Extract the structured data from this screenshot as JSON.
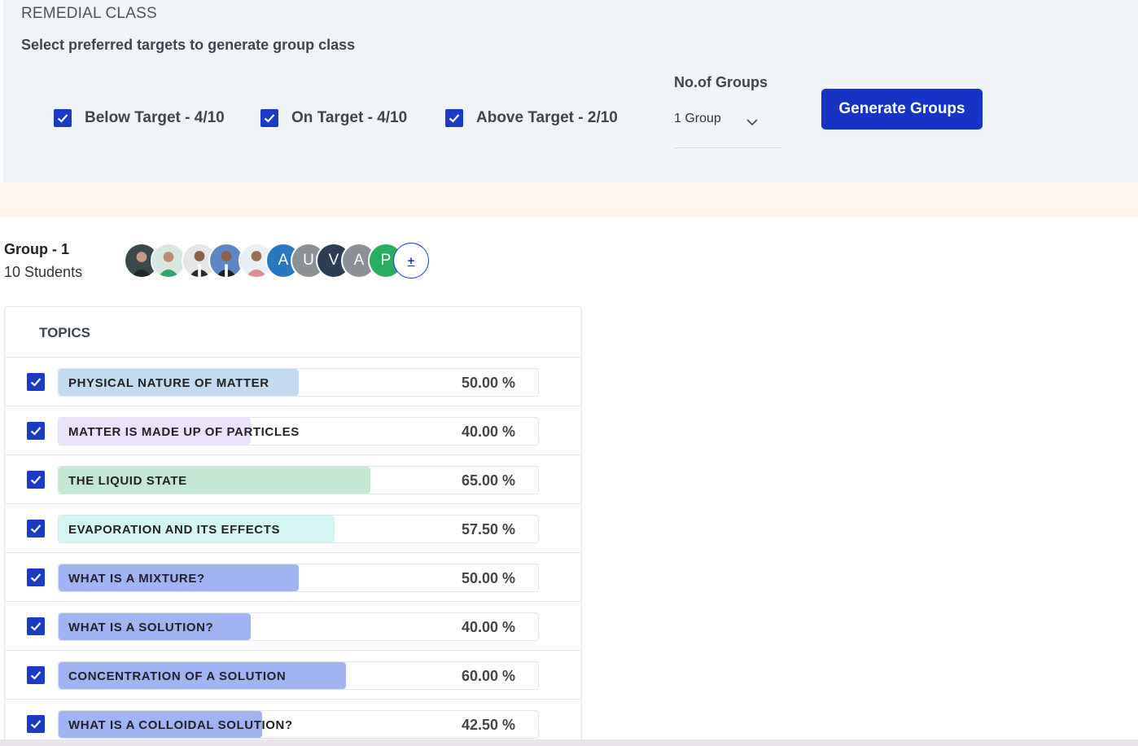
{
  "header": {
    "title": "REMEDIAL CLASS",
    "subtitle": "Select preferred targets to generate group class"
  },
  "targets": [
    {
      "label": "Below Target - 4/10",
      "checked": true
    },
    {
      "label": "On Target - 4/10",
      "checked": true
    },
    {
      "label": "Above Target - 2/10",
      "checked": true
    }
  ],
  "groups_select": {
    "label": "No.of Groups",
    "value": "1 Group"
  },
  "generate_button": "Generate Groups",
  "group": {
    "title": "Group - 1",
    "count": "10 Students",
    "avatars": [
      {
        "type": "photo",
        "bg": "#3a4a4c"
      },
      {
        "type": "photo",
        "bg": "#7fb59a"
      },
      {
        "type": "photo",
        "bg": "#c9c9c9"
      },
      {
        "type": "photo",
        "bg": "#4a73b8"
      },
      {
        "type": "photo",
        "bg": "#f0d2c8"
      },
      {
        "type": "initial",
        "letter": "A",
        "bg": "#2878c0"
      },
      {
        "type": "initial",
        "letter": "U",
        "bg": "#8a9297"
      },
      {
        "type": "initial",
        "letter": "V",
        "bg": "#2c3e55"
      },
      {
        "type": "initial",
        "letter": "A",
        "bg": "#8a9297"
      },
      {
        "type": "initial",
        "letter": "P",
        "bg": "#27ae60"
      }
    ],
    "add_label": "+"
  },
  "topics": {
    "header": "TOPICS",
    "rows": [
      {
        "name": "PHYSICAL NATURE OF MATTER",
        "percent": "50.00 %",
        "value": 50.0,
        "color": "#c2dbf0"
      },
      {
        "name": "MATTER IS MADE UP OF PARTICLES",
        "percent": "40.00 %",
        "value": 40.0,
        "color": "#ebe3fb"
      },
      {
        "name": "THE LIQUID STATE",
        "percent": "65.00 %",
        "value": 65.0,
        "color": "#c3e9d4"
      },
      {
        "name": "EVAPORATION AND ITS EFFECTS",
        "percent": "57.50 %",
        "value": 57.5,
        "color": "#d4f6f2"
      },
      {
        "name": "WHAT IS A MIXTURE?",
        "percent": "50.00 %",
        "value": 50.0,
        "color": "#a0b4f4"
      },
      {
        "name": "WHAT IS A SOLUTION?",
        "percent": "40.00 %",
        "value": 40.0,
        "color": "#a0b4f4"
      },
      {
        "name": "CONCENTRATION OF A SOLUTION",
        "percent": "60.00 %",
        "value": 60.0,
        "color": "#a0b4f4"
      },
      {
        "name": "WHAT IS A COLLOIDAL SOLUTION?",
        "percent": "42.50 %",
        "value": 42.5,
        "color": "#a0b4f4"
      }
    ]
  },
  "colors": {
    "accent": "#1533c4",
    "panel_bg": "#f1f4f7",
    "band_bg": "#fff5ec"
  }
}
